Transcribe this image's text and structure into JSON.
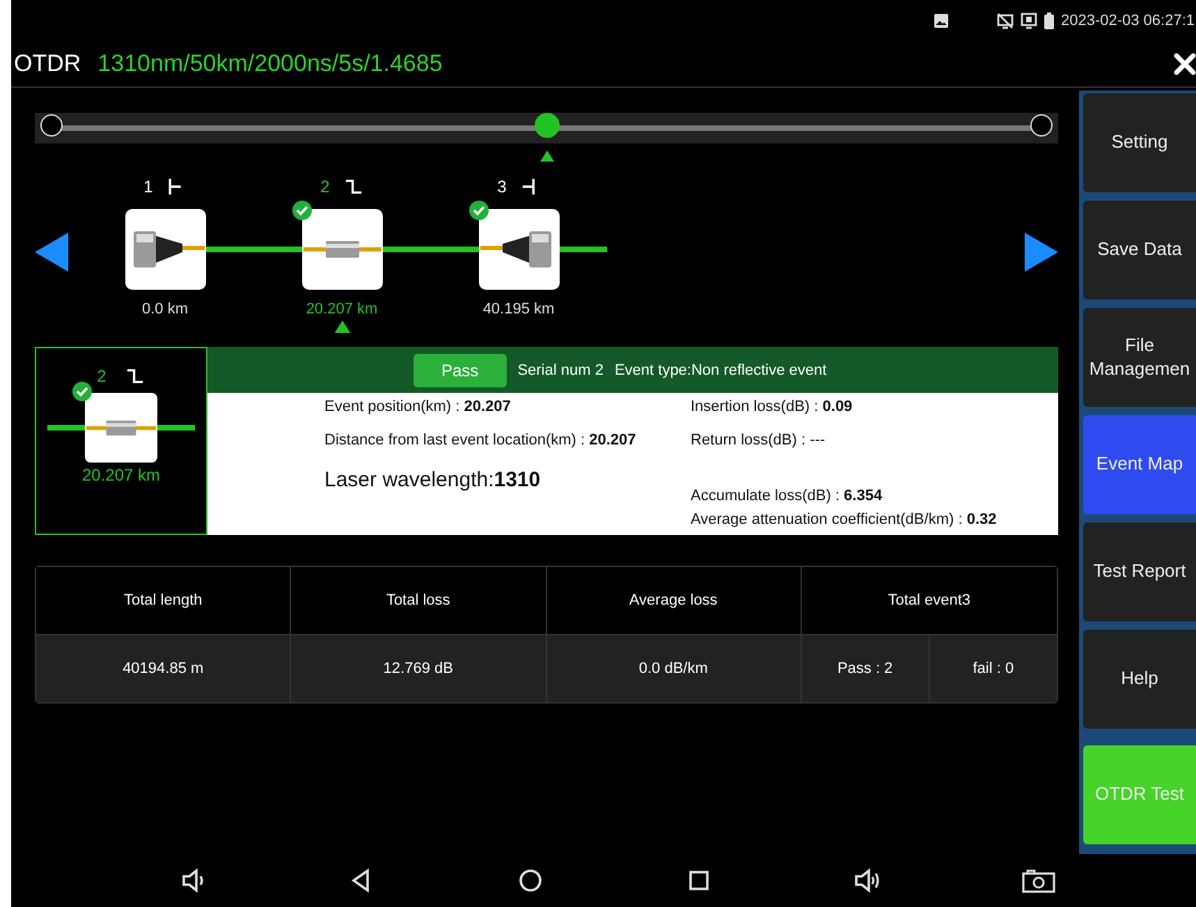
{
  "status_bar": {
    "datetime": "2023-02-03 06:27:1"
  },
  "title_bar": {
    "app": "OTDR",
    "params": "1310nm/50km/2000ns/5s/1.4685"
  },
  "slider": {
    "level": 0.5
  },
  "events": [
    {
      "number": "1",
      "kind": "start",
      "distance": "0.0 km",
      "passed": false,
      "selected": false
    },
    {
      "number": "2",
      "kind": "splice",
      "distance": "20.207 km",
      "passed": true,
      "selected": true
    },
    {
      "number": "3",
      "kind": "end",
      "distance": "40.195 km",
      "passed": true,
      "selected": false
    }
  ],
  "detail": {
    "number": "2",
    "kind": "splice",
    "passed": true,
    "distance": "20.207 km",
    "status": "Pass",
    "serial": "Serial num 2",
    "event_type": "Event type:Non reflective event",
    "left_fields": [
      {
        "kind": "small",
        "text": "Event position(km) : **20.207**"
      },
      {
        "kind": "small",
        "text": "Distance from last event location(km) : **20.207**"
      },
      {
        "kind": "large",
        "text": "Laser wavelength:**1310**"
      }
    ],
    "right_fields": [
      "Insertion loss(dB) : **0.09**",
      "Return loss(dB) : ---",
      "Accumulate loss(dB) : **6.354**",
      "Average attenuation coefficient(dB/km) : **0.32**"
    ]
  },
  "summary": {
    "headers": [
      "Total length",
      "Total loss",
      "Average loss",
      "Total event3"
    ],
    "values": [
      "40194.85 m",
      "12.769 dB",
      "0.0 dB/km"
    ],
    "pass": "Pass : 2",
    "fail": "fail : 0"
  },
  "sidebar": [
    {
      "label": "Setting",
      "kind": "normal",
      "selected": false
    },
    {
      "label": "Save Data",
      "kind": "normal",
      "selected": false
    },
    {
      "label": "File Managemen",
      "kind": "normal",
      "selected": false
    },
    {
      "label": "Event Map",
      "kind": "normal",
      "selected": true
    },
    {
      "label": "Test Report",
      "kind": "normal",
      "selected": false
    },
    {
      "label": "Help",
      "kind": "normal",
      "selected": false
    },
    {
      "label": "OTDR Test",
      "kind": "action",
      "selected": false
    }
  ]
}
